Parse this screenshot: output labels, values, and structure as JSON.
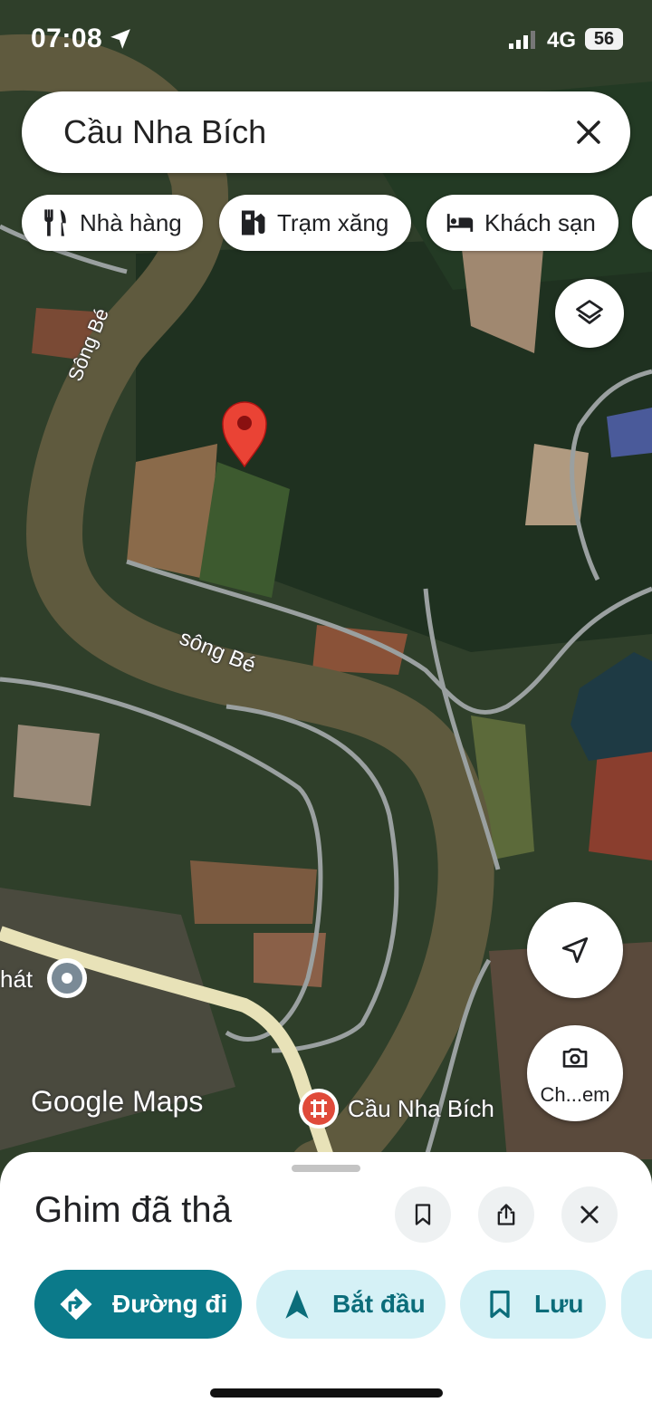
{
  "status_bar": {
    "time": "07:08",
    "network": "4G",
    "battery": "56"
  },
  "search": {
    "query": "Cầu Nha Bích"
  },
  "chips": [
    {
      "label": "Nhà hàng",
      "icon": "fork-knife-icon"
    },
    {
      "label": "Trạm xăng",
      "icon": "gas-pump-icon"
    },
    {
      "label": "Khách sạn",
      "icon": "bed-icon"
    }
  ],
  "map": {
    "river_label_top": "Sông Bé",
    "river_label_mid": "sông Bé",
    "bridge_label": "Cầu Nha Bích",
    "left_poi_label": "hát",
    "street_view_label": "Ch...em",
    "watermark": "Google Maps",
    "pin_color": "#ea4335"
  },
  "sheet": {
    "title": "Ghim đã thả",
    "actions": [
      {
        "label": "Đường đi",
        "icon": "directions-icon"
      },
      {
        "label": "Bắt đầu",
        "icon": "navigation-arrow-icon"
      },
      {
        "label": "Lưu",
        "icon": "bookmark-icon"
      }
    ]
  },
  "colors": {
    "accent": "#0b7a8a",
    "chip_bg": "#d5f1f6",
    "accent_text": "#0b6d7a"
  }
}
